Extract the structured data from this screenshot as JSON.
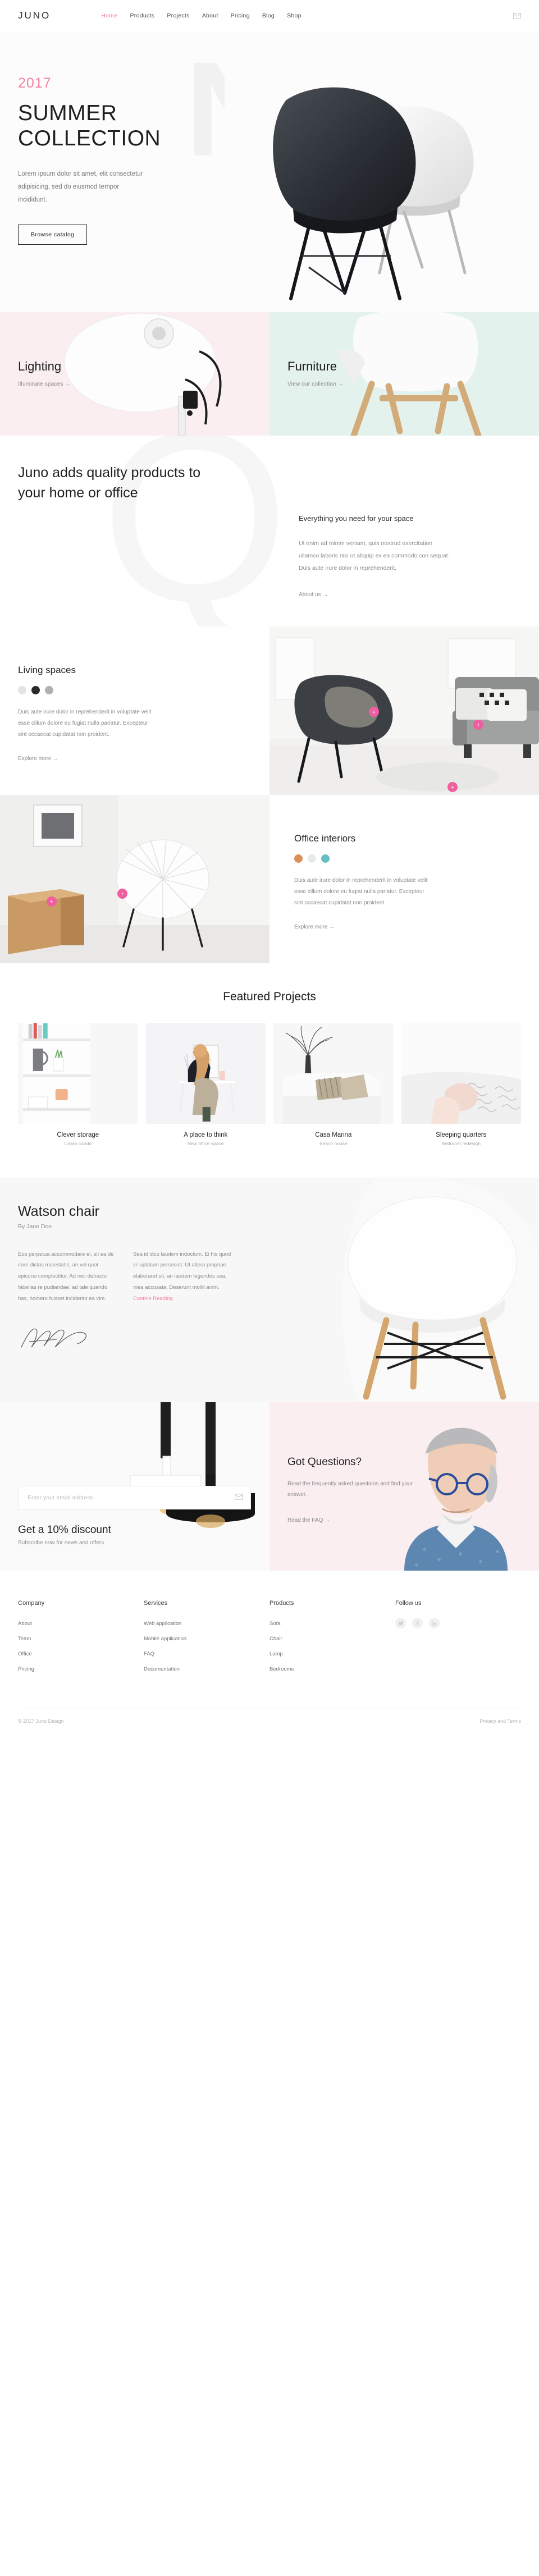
{
  "header": {
    "brand": "JUNO",
    "nav": [
      {
        "label": "Home",
        "active": true
      },
      {
        "label": "Products",
        "active": false
      },
      {
        "label": "Projects",
        "active": false
      },
      {
        "label": "About",
        "active": false
      },
      {
        "label": "Pricing",
        "active": false
      },
      {
        "label": "Blog",
        "active": false
      },
      {
        "label": "Shop",
        "active": false
      }
    ],
    "mail_icon": "envelope-icon"
  },
  "hero": {
    "ghost_text": "NEW",
    "year": "2017",
    "title": "SUMMER COLLECTION",
    "description": "Lorem ipsum dolor sit amet, elit consectetur adipisicing, sed do eiusmod tempor incididunt.",
    "cta": "Browse catalog"
  },
  "categories": [
    {
      "title": "Lighting",
      "link": "Illuminate spaces →",
      "bg": "#fbeef1"
    },
    {
      "title": "Furniture",
      "link": "View our collection →",
      "bg": "#e4f2ee"
    }
  ],
  "quality": {
    "ghost_letter": "Q",
    "title": "Juno adds quality products to your home or office",
    "subtitle": "Everything you need for your space",
    "text": "Ut enim ad minim veniam, quis nostrud exercitation ullamco laboris nisi ut aliquip ex ea commodo con sequat. Duis aute irure dolor in reprehenderit.",
    "link": "About us →"
  },
  "living": {
    "title": "Living spaces",
    "swatches": [
      "#e3e3e3",
      "#2b2b2b",
      "#b0b0b0"
    ],
    "text": "Duis aute irure dolor in reprehenderit in voluptate velit esse cillum dolore eu fugiat nulla pariatur. Excepteur sint occaecat cupidatat non proident.",
    "link": "Explore more →",
    "hotspot_symbol": "+"
  },
  "office": {
    "title": "Office interiors",
    "swatches": [
      "#dd8f5a",
      "#e6eae9",
      "#67bfc3"
    ],
    "text": "Duis aute irure dolor in reprehenderit in voluptate velit esse cillum dolore eu fugiat nulla pariatur. Excepteur sint occaecat cupidatat non proident.",
    "link": "Explore more →",
    "hotspot_symbol": "+"
  },
  "projects": {
    "title": "Featured Projects",
    "items": [
      {
        "name": "Clever storage",
        "meta": "Urban condo"
      },
      {
        "name": "A place to think",
        "meta": "New office space"
      },
      {
        "name": "Casa Marina",
        "meta": "Beach house"
      },
      {
        "name": "Sleeping quarters",
        "meta": "Bedroom redesign"
      }
    ]
  },
  "watson": {
    "title": "Watson chair",
    "byline": "By Jane Doe",
    "col1": "Eos perpetua accommodare ei, sit ea de core dictas maiestatis, an vel quot epicurei complectitur. Ad nec detracto fabellas re pudiandae, ad tale quando has, homero fuisset inciderint ea vim.",
    "col2": "Sea id dico laudem indoctum. Ei his quod si luptatum persecuti. Ut altera propriae elaboraret sit, an laudem legendos sea, mea accusata. Deserunt mollit anim.",
    "continue": "Contine Reading",
    "signature_alt": "signature-mark"
  },
  "newsletter": {
    "email_placeholder": "Enter your email address",
    "email_value": "",
    "submit_icon": "envelope-icon",
    "heading": "Get a 10% discount",
    "subtext": "Subscribe now for news and offers"
  },
  "faq": {
    "heading": "Got Questions?",
    "text": "Read the frequently asked questions and find your answer.",
    "link": "Read the FAQ →"
  },
  "footer": {
    "columns": [
      {
        "title": "Company",
        "links": [
          "About",
          "Team",
          "Office",
          "Pricing"
        ]
      },
      {
        "title": "Services",
        "links": [
          "Web application",
          "Mobile application",
          "FAQ",
          "Documentation"
        ]
      },
      {
        "title": "Products",
        "links": [
          "Sofa",
          "Chair",
          "Lamp",
          "Bedrooms"
        ]
      }
    ],
    "follow_title": "Follow us",
    "social": [
      "twitter-icon",
      "facebook-icon",
      "linkedin-icon"
    ],
    "copyright": "© 2017 Juno Design",
    "legal": "Privacy and Terms"
  },
  "colors": {
    "accent_pink": "#f2849e",
    "hotspot_pink": "#ef5fa0",
    "lighting_bg": "#fbeef1",
    "furniture_bg": "#e4f2ee"
  }
}
